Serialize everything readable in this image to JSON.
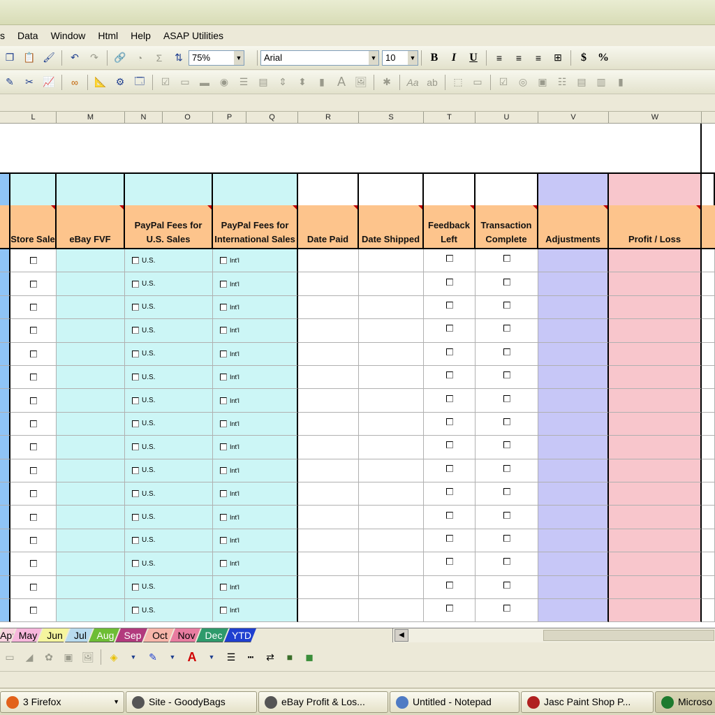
{
  "menu": [
    "s",
    "Data",
    "Window",
    "Html",
    "Help",
    "ASAP Utilities"
  ],
  "toolbar1": {
    "zoom": "75%",
    "font_name": "Arial",
    "font_size": "10",
    "bold": "B",
    "italic": "I",
    "underline": "U",
    "currency": "$",
    "percent": "%"
  },
  "columns": [
    "L",
    "M",
    "N",
    "O",
    "P",
    "Q",
    "R",
    "S",
    "T",
    "U",
    "V",
    "W"
  ],
  "headers": {
    "store_sale": "Store Sale",
    "ebay_fvf": "eBay FVF",
    "paypal_us": "PayPal Fees for U.S. Sales",
    "paypal_intl": "PayPal Fees for International Sales",
    "date_paid": "Date Paid",
    "date_shipped": "Date Shipped",
    "feedback_left": "Feedback Left",
    "transaction_complete": "Transaction Complete",
    "adjustments": "Adjustments",
    "profit_loss": "Profit / Loss"
  },
  "checkbox_labels": {
    "us": "U.S.",
    "intl": "Int'l"
  },
  "row_count": 16,
  "colors": {
    "header_orange": "#fdc48c",
    "light_cyan": "#ccf6f6",
    "left_blue": "#8fc4f6",
    "lavender": "#c7c7f7",
    "pink": "#f8c6cc"
  },
  "sheet_tabs": [
    {
      "label": "Apr",
      "color": "#f8d3df"
    },
    {
      "label": "May",
      "color": "#f6b6dc"
    },
    {
      "label": "Jun",
      "color": "#f5f59e"
    },
    {
      "label": "Jul",
      "color": "#b8dbef"
    },
    {
      "label": "Aug",
      "color": "#6dbd35"
    },
    {
      "label": "Sep",
      "color": "#b23a7d"
    },
    {
      "label": "Oct",
      "color": "#f7b6aa"
    },
    {
      "label": "Nov",
      "color": "#e87ca0"
    },
    {
      "label": "Dec",
      "color": "#2e9a6b"
    },
    {
      "label": "YTD",
      "color": "#1f3fd0"
    }
  ],
  "taskbar": [
    {
      "label": "3 Firefox",
      "icon_color": "#e2621b"
    },
    {
      "label": "Site - GoodyBags",
      "icon_color": "#555555"
    },
    {
      "label": "eBay Profit & Los...",
      "icon_color": "#555555"
    },
    {
      "label": "Untitled - Notepad",
      "icon_color": "#4f7bc4"
    },
    {
      "label": "Jasc Paint Shop P...",
      "icon_color": "#b02020"
    },
    {
      "label": "Microso",
      "icon_color": "#1d7a2e"
    }
  ]
}
